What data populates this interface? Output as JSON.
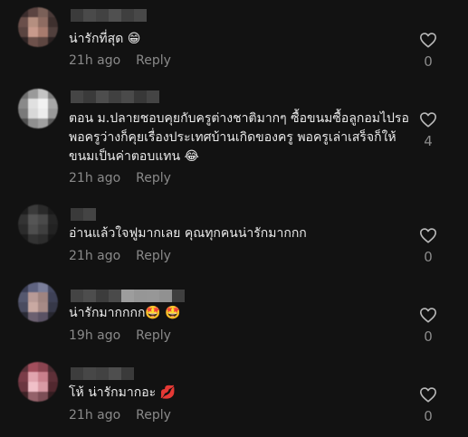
{
  "comments": [
    {
      "text": "น่ารักที่สุด 😁",
      "time": "21h ago",
      "reply_label": "Reply",
      "likes": "0"
    },
    {
      "text": "ตอน ม.ปลายชอบคุยกับครูต่างชาติมากๆ ซื้อขนมซื้อลูกอมไปรอพอครูว่างก็คุยเรื่องประเทศบ้านเกิดของครู พอครูเล่าเสร็จก็ให้ขนมเป็นค่าตอบแทน 😂",
      "time": "21h ago",
      "reply_label": "Reply",
      "likes": "4"
    },
    {
      "text": "อ่านแล้วใจฟูมากเลย คุณทุกคนน่ารักมากกก",
      "time": "21h ago",
      "reply_label": "Reply",
      "likes": "0"
    },
    {
      "text": "น่ารักมากกกก🤩 🤩",
      "time": "19h ago",
      "reply_label": "Reply",
      "likes": "0"
    },
    {
      "text": "โห้ น่ารักมากอะ 💋",
      "time": "21h ago",
      "reply_label": "Reply",
      "likes": "0"
    }
  ],
  "colors": {
    "background": "#121212",
    "text": "#eaeaea",
    "muted": "#8a8a8a"
  },
  "icons": {
    "like": "heart-outline-icon"
  }
}
